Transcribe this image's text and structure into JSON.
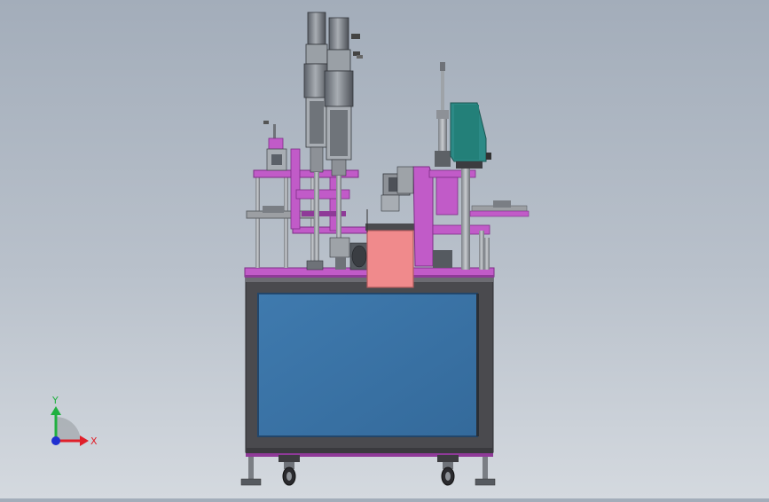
{
  "triad": {
    "x_label": "X",
    "y_label": "Y",
    "x_color": "#e0202a",
    "y_color": "#20b040",
    "z_color": "#2030d0"
  },
  "colors": {
    "frame": "#4a4a4e",
    "frame_light": "#6c6c72",
    "panel": "#3b73a6",
    "panel_edge": "#22466b",
    "magenta": "#c15bc8",
    "magenta_dark": "#8f3a98",
    "teal": "#2c8a86",
    "pink_box": "#f08a8c",
    "steel": "#9ea3a8",
    "steel_dark": "#5d6166"
  }
}
